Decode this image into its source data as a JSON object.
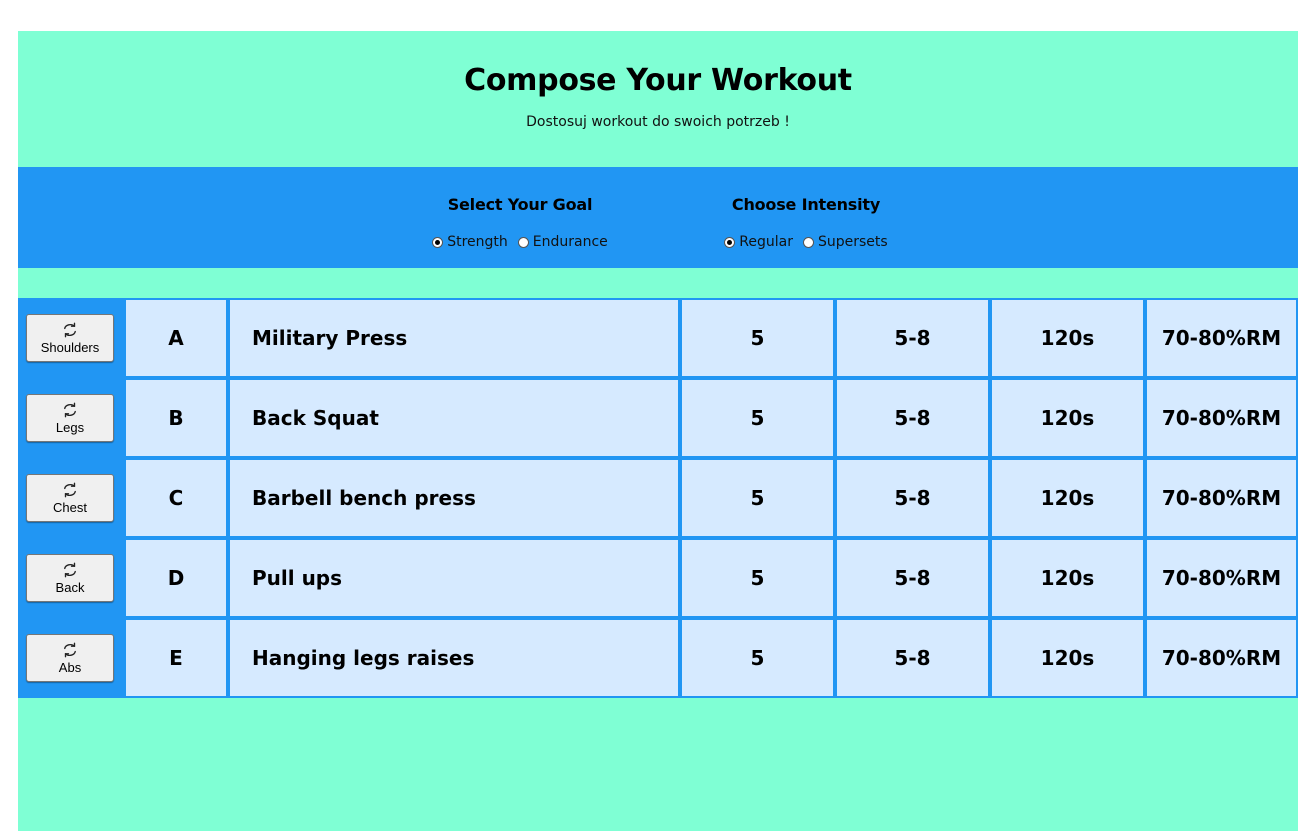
{
  "header": {
    "title": "Compose Your Workout",
    "subtitle": "Dostosuj workout do swoich potrzeb !"
  },
  "goal": {
    "heading": "Select Your Goal",
    "options": [
      {
        "label": "Strength",
        "checked": true
      },
      {
        "label": "Endurance",
        "checked": false
      }
    ]
  },
  "intensity": {
    "heading": "Choose Intensity",
    "options": [
      {
        "label": "Regular",
        "checked": true
      },
      {
        "label": "Supersets",
        "checked": false
      }
    ]
  },
  "exercises": [
    {
      "button": "Shoulders",
      "letter": "A",
      "name": "Military Press",
      "sets": "5",
      "reps": "5-8",
      "rest": "120s",
      "load": "70-80%RM"
    },
    {
      "button": "Legs",
      "letter": "B",
      "name": "Back Squat",
      "sets": "5",
      "reps": "5-8",
      "rest": "120s",
      "load": "70-80%RM"
    },
    {
      "button": "Chest",
      "letter": "C",
      "name": "Barbell bench press",
      "sets": "5",
      "reps": "5-8",
      "rest": "120s",
      "load": "70-80%RM"
    },
    {
      "button": "Back",
      "letter": "D",
      "name": "Pull ups",
      "sets": "5",
      "reps": "5-8",
      "rest": "120s",
      "load": "70-80%RM"
    },
    {
      "button": "Abs",
      "letter": "E",
      "name": "Hanging legs raises",
      "sets": "5",
      "reps": "5-8",
      "rest": "120s",
      "load": "70-80%RM"
    }
  ],
  "icons": {
    "swap": "swap-icon"
  },
  "colors": {
    "background": "#7fffd4",
    "bar": "#2196f3",
    "cell": "#d6eaff"
  }
}
